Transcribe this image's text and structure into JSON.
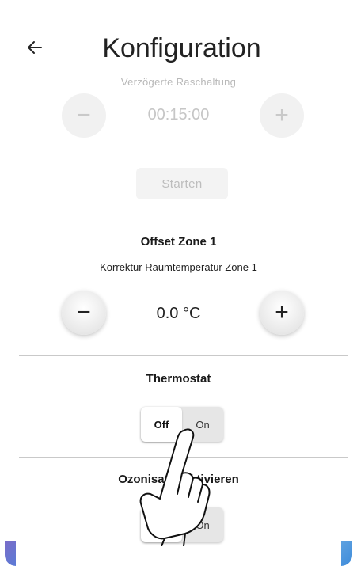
{
  "header": {
    "back_icon": "arrow-left-icon",
    "title": "Konfiguration"
  },
  "delayed_section": {
    "faded_label": "Verzögerte Raschaltung",
    "minus_label": "−",
    "plus_label": "+",
    "value": "00:15:00",
    "start_label": "Starten"
  },
  "offset_section": {
    "title": "Offset Zone 1",
    "subtitle": "Korrektur Raumtemperatur Zone 1",
    "minus_label": "−",
    "plus_label": "+",
    "value": "0.0 °C"
  },
  "thermostat_section": {
    "title": "Thermostat",
    "off_label": "Off",
    "on_label": "On",
    "selected": "Off"
  },
  "ozon_section": {
    "title": "Ozonisator aktivieren",
    "off_label": "Off",
    "on_label": "On",
    "selected": "Off"
  },
  "colors": {
    "accent_left": "#7a6cc8",
    "accent_right": "#3d8bdb",
    "divider": "#c9c9c9"
  }
}
